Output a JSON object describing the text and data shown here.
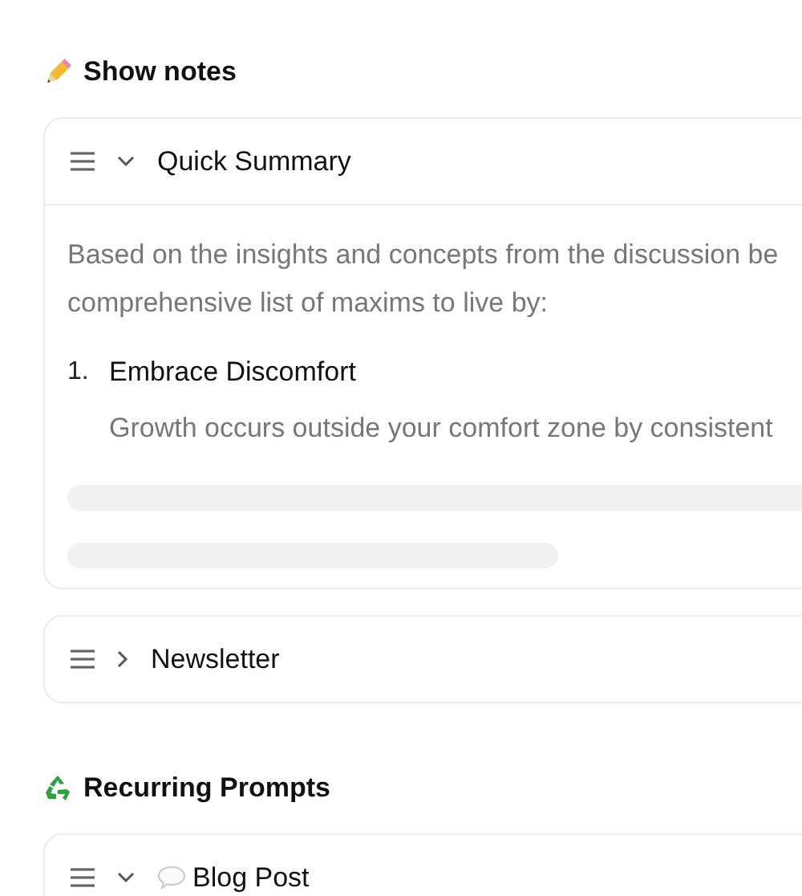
{
  "sections": [
    {
      "heading": "Show notes",
      "cards": [
        {
          "title": "Quick Summary",
          "kind": "plain",
          "expanded": true,
          "body": {
            "intro": "Based on the insights and concepts from the discussion be",
            "line2": "comprehensive list of maxims to live by:",
            "items": [
              {
                "number": "1.",
                "title": "Embrace Discomfort",
                "text": "Growth occurs outside your comfort zone by consistent"
              }
            ],
            "loading": true
          }
        },
        {
          "title": "Newsletter",
          "kind": "plain",
          "expanded": false
        }
      ]
    },
    {
      "heading": "Recurring Prompts",
      "cards": [
        {
          "title": "Blog Post",
          "kind": "prompt",
          "expanded": true
        }
      ]
    }
  ]
}
